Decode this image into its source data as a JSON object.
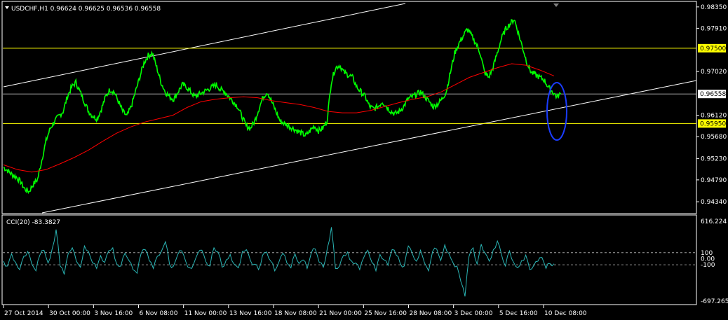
{
  "window": {
    "symbol_header": "USDCHF,H1  0.96624 0.96625 0.96536 0.96558",
    "menu_icon": "triangle-down-icon",
    "scroll_marker_icon": "triangle-down-icon"
  },
  "colors": {
    "background": "#000000",
    "price": "#00ff00",
    "moving_average": "#ff0000",
    "channel": "#ffffff",
    "horizontal_levels": "#ffff00",
    "current_price_line": "#c0c0c0",
    "highlight_ellipse": "#1a3cff",
    "cci": "#2ab5b5",
    "cci_levels": "#c0c0c0",
    "axis_text": "#ffffff"
  },
  "chart_data": [
    {
      "type": "line",
      "title": "USDCHF,H1",
      "subtitle": "0.96624 0.96625 0.96536 0.96558",
      "ylim": [
        0.9414,
        0.9842
      ],
      "y_ticks": [
        "0.98350",
        "0.97910",
        "0.97020",
        "0.96120",
        "0.95680",
        "0.95230",
        "0.94790",
        "0.94340"
      ],
      "x_ticks": [
        "27 Oct 2014",
        "30 Oct 00:00",
        "3 Nov 16:00",
        "6 Nov 08:00",
        "11 Nov 00:00",
        "13 Nov 16:00",
        "18 Nov 08:00",
        "21 Nov 00:00",
        "25 Nov 16:00",
        "28 Nov 08:00",
        "3 Dec 00:00",
        "5 Dec 16:00",
        "10 Dec 08:00"
      ],
      "horizontal_levels": [
        {
          "value": 0.975,
          "label": "0.97500",
          "color": "#ffff00"
        },
        {
          "value": 0.9595,
          "label": "0.95950",
          "color": "#ffff00"
        }
      ],
      "current_price": {
        "value": 0.96558,
        "label": "0.96558"
      },
      "series": [
        {
          "key": "close",
          "color": "#00ff00",
          "values": [
            0.9505,
            0.9498,
            0.949,
            0.9485,
            0.9475,
            0.946,
            0.9455,
            0.947,
            0.948,
            0.952,
            0.956,
            0.9585,
            0.96,
            0.961,
            0.962,
            0.965,
            0.967,
            0.968,
            0.966,
            0.964,
            0.962,
            0.961,
            0.9605,
            0.9625,
            0.965,
            0.9665,
            0.966,
            0.964,
            0.962,
            0.961,
            0.963,
            0.966,
            0.969,
            0.972,
            0.9735,
            0.974,
            0.971,
            0.968,
            0.966,
            0.965,
            0.9645,
            0.966,
            0.9675,
            0.967,
            0.966,
            0.965,
            0.9655,
            0.966,
            0.9665,
            0.967,
            0.9675,
            0.9665,
            0.966,
            0.965,
            0.964,
            0.963,
            0.961,
            0.959,
            0.9585,
            0.96,
            0.9625,
            0.965,
            0.966,
            0.964,
            0.962,
            0.96,
            0.9595,
            0.959,
            0.9585,
            0.958,
            0.9575,
            0.957,
            0.958,
            0.959,
            0.958,
            0.9585,
            0.96,
            0.968,
            0.971,
            0.9715,
            0.97,
            0.9695,
            0.969,
            0.967,
            0.966,
            0.965,
            0.963,
            0.9625,
            0.963,
            0.964,
            0.963,
            0.962,
            0.9615,
            0.962,
            0.963,
            0.9645,
            0.965,
            0.9655,
            0.966,
            0.965,
            0.964,
            0.963,
            0.9635,
            0.9645,
            0.966,
            0.97,
            0.974,
            0.976,
            0.9775,
            0.979,
            0.9775,
            0.976,
            0.974,
            0.97,
            0.969,
            0.971,
            0.974,
            0.977,
            0.979,
            0.98,
            0.981,
            0.978,
            0.975,
            0.972,
            0.97,
            0.9695,
            0.969,
            0.9685,
            0.967,
            0.966,
            0.965,
            0.9656
          ]
        },
        {
          "key": "moving_average",
          "color": "#ff0000",
          "values": [
            0.951,
            0.95,
            0.9495,
            0.95,
            0.9512,
            0.9525,
            0.954,
            0.9558,
            0.9575,
            0.9588,
            0.9598,
            0.9605,
            0.9612,
            0.9628,
            0.964,
            0.9645,
            0.9648,
            0.965,
            0.9648,
            0.9642,
            0.9638,
            0.9634,
            0.9628,
            0.962,
            0.9617,
            0.9617,
            0.9622,
            0.963,
            0.9638,
            0.9645,
            0.965,
            0.966,
            0.9675,
            0.969,
            0.97,
            0.971,
            0.9718,
            0.9715,
            0.9705,
            0.9693
          ]
        }
      ]
    },
    {
      "type": "line",
      "title": "CCI(20) -83.3827",
      "ylim": [
        -697.2655,
        616.224
      ],
      "y_ticks": [
        "616.224",
        "100",
        "0.00",
        "-100",
        "-697.2655"
      ],
      "levels": [
        100,
        -100
      ],
      "series": [
        {
          "key": "cci",
          "color": "#2ab5b5",
          "values": [
            -40,
            -120,
            80,
            -60,
            -180,
            40,
            120,
            -90,
            -200,
            60,
            140,
            -70,
            160,
            480,
            -120,
            -260,
            90,
            180,
            -40,
            -140,
            210,
            120,
            -70,
            -160,
            50,
            -60,
            130,
            180,
            -90,
            -120,
            90,
            -30,
            -180,
            -240,
            90,
            150,
            -30,
            -160,
            40,
            120,
            280,
            -90,
            -120,
            60,
            130,
            -40,
            -150,
            -80,
            90,
            140,
            -50,
            -120,
            180,
            110,
            -140,
            -20,
            70,
            -90,
            -150,
            120,
            150,
            -30,
            -90,
            -180,
            60,
            110,
            -40,
            -200,
            -60,
            90,
            -70,
            -150,
            80,
            -80,
            -20,
            -160,
            90,
            160,
            -60,
            -140,
            180,
            520,
            -160,
            -120,
            60,
            110,
            -40,
            -70,
            -180,
            20,
            140,
            -60,
            -200,
            70,
            -20,
            -110,
            150,
            60,
            -80,
            -120,
            210,
            80,
            -40,
            140,
            -70,
            -200,
            120,
            160,
            -30,
            230,
            90,
            -60,
            -120,
            -380,
            -620,
            40,
            180,
            -90,
            240,
            90,
            -40,
            150,
            290,
            70,
            -120,
            130,
            -60,
            -150,
            -30,
            60,
            -180,
            -110,
            -40,
            20,
            -160,
            -80,
            -83
          ]
        }
      ]
    }
  ]
}
